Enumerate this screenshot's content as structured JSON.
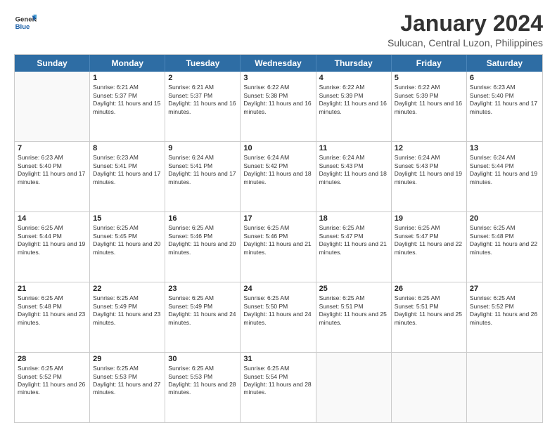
{
  "logo": {
    "general": "General",
    "blue": "Blue"
  },
  "header": {
    "month": "January 2024",
    "location": "Sulucan, Central Luzon, Philippines"
  },
  "days": [
    "Sunday",
    "Monday",
    "Tuesday",
    "Wednesday",
    "Thursday",
    "Friday",
    "Saturday"
  ],
  "weeks": [
    [
      {
        "date": "",
        "sunrise": "",
        "sunset": "",
        "daylight": ""
      },
      {
        "date": "1",
        "sunrise": "Sunrise: 6:21 AM",
        "sunset": "Sunset: 5:37 PM",
        "daylight": "Daylight: 11 hours and 15 minutes."
      },
      {
        "date": "2",
        "sunrise": "Sunrise: 6:21 AM",
        "sunset": "Sunset: 5:37 PM",
        "daylight": "Daylight: 11 hours and 16 minutes."
      },
      {
        "date": "3",
        "sunrise": "Sunrise: 6:22 AM",
        "sunset": "Sunset: 5:38 PM",
        "daylight": "Daylight: 11 hours and 16 minutes."
      },
      {
        "date": "4",
        "sunrise": "Sunrise: 6:22 AM",
        "sunset": "Sunset: 5:39 PM",
        "daylight": "Daylight: 11 hours and 16 minutes."
      },
      {
        "date": "5",
        "sunrise": "Sunrise: 6:22 AM",
        "sunset": "Sunset: 5:39 PM",
        "daylight": "Daylight: 11 hours and 16 minutes."
      },
      {
        "date": "6",
        "sunrise": "Sunrise: 6:23 AM",
        "sunset": "Sunset: 5:40 PM",
        "daylight": "Daylight: 11 hours and 17 minutes."
      }
    ],
    [
      {
        "date": "7",
        "sunrise": "Sunrise: 6:23 AM",
        "sunset": "Sunset: 5:40 PM",
        "daylight": "Daylight: 11 hours and 17 minutes."
      },
      {
        "date": "8",
        "sunrise": "Sunrise: 6:23 AM",
        "sunset": "Sunset: 5:41 PM",
        "daylight": "Daylight: 11 hours and 17 minutes."
      },
      {
        "date": "9",
        "sunrise": "Sunrise: 6:24 AM",
        "sunset": "Sunset: 5:41 PM",
        "daylight": "Daylight: 11 hours and 17 minutes."
      },
      {
        "date": "10",
        "sunrise": "Sunrise: 6:24 AM",
        "sunset": "Sunset: 5:42 PM",
        "daylight": "Daylight: 11 hours and 18 minutes."
      },
      {
        "date": "11",
        "sunrise": "Sunrise: 6:24 AM",
        "sunset": "Sunset: 5:43 PM",
        "daylight": "Daylight: 11 hours and 18 minutes."
      },
      {
        "date": "12",
        "sunrise": "Sunrise: 6:24 AM",
        "sunset": "Sunset: 5:43 PM",
        "daylight": "Daylight: 11 hours and 19 minutes."
      },
      {
        "date": "13",
        "sunrise": "Sunrise: 6:24 AM",
        "sunset": "Sunset: 5:44 PM",
        "daylight": "Daylight: 11 hours and 19 minutes."
      }
    ],
    [
      {
        "date": "14",
        "sunrise": "Sunrise: 6:25 AM",
        "sunset": "Sunset: 5:44 PM",
        "daylight": "Daylight: 11 hours and 19 minutes."
      },
      {
        "date": "15",
        "sunrise": "Sunrise: 6:25 AM",
        "sunset": "Sunset: 5:45 PM",
        "daylight": "Daylight: 11 hours and 20 minutes."
      },
      {
        "date": "16",
        "sunrise": "Sunrise: 6:25 AM",
        "sunset": "Sunset: 5:46 PM",
        "daylight": "Daylight: 11 hours and 20 minutes."
      },
      {
        "date": "17",
        "sunrise": "Sunrise: 6:25 AM",
        "sunset": "Sunset: 5:46 PM",
        "daylight": "Daylight: 11 hours and 21 minutes."
      },
      {
        "date": "18",
        "sunrise": "Sunrise: 6:25 AM",
        "sunset": "Sunset: 5:47 PM",
        "daylight": "Daylight: 11 hours and 21 minutes."
      },
      {
        "date": "19",
        "sunrise": "Sunrise: 6:25 AM",
        "sunset": "Sunset: 5:47 PM",
        "daylight": "Daylight: 11 hours and 22 minutes."
      },
      {
        "date": "20",
        "sunrise": "Sunrise: 6:25 AM",
        "sunset": "Sunset: 5:48 PM",
        "daylight": "Daylight: 11 hours and 22 minutes."
      }
    ],
    [
      {
        "date": "21",
        "sunrise": "Sunrise: 6:25 AM",
        "sunset": "Sunset: 5:48 PM",
        "daylight": "Daylight: 11 hours and 23 minutes."
      },
      {
        "date": "22",
        "sunrise": "Sunrise: 6:25 AM",
        "sunset": "Sunset: 5:49 PM",
        "daylight": "Daylight: 11 hours and 23 minutes."
      },
      {
        "date": "23",
        "sunrise": "Sunrise: 6:25 AM",
        "sunset": "Sunset: 5:49 PM",
        "daylight": "Daylight: 11 hours and 24 minutes."
      },
      {
        "date": "24",
        "sunrise": "Sunrise: 6:25 AM",
        "sunset": "Sunset: 5:50 PM",
        "daylight": "Daylight: 11 hours and 24 minutes."
      },
      {
        "date": "25",
        "sunrise": "Sunrise: 6:25 AM",
        "sunset": "Sunset: 5:51 PM",
        "daylight": "Daylight: 11 hours and 25 minutes."
      },
      {
        "date": "26",
        "sunrise": "Sunrise: 6:25 AM",
        "sunset": "Sunset: 5:51 PM",
        "daylight": "Daylight: 11 hours and 25 minutes."
      },
      {
        "date": "27",
        "sunrise": "Sunrise: 6:25 AM",
        "sunset": "Sunset: 5:52 PM",
        "daylight": "Daylight: 11 hours and 26 minutes."
      }
    ],
    [
      {
        "date": "28",
        "sunrise": "Sunrise: 6:25 AM",
        "sunset": "Sunset: 5:52 PM",
        "daylight": "Daylight: 11 hours and 26 minutes."
      },
      {
        "date": "29",
        "sunrise": "Sunrise: 6:25 AM",
        "sunset": "Sunset: 5:53 PM",
        "daylight": "Daylight: 11 hours and 27 minutes."
      },
      {
        "date": "30",
        "sunrise": "Sunrise: 6:25 AM",
        "sunset": "Sunset: 5:53 PM",
        "daylight": "Daylight: 11 hours and 28 minutes."
      },
      {
        "date": "31",
        "sunrise": "Sunrise: 6:25 AM",
        "sunset": "Sunset: 5:54 PM",
        "daylight": "Daylight: 11 hours and 28 minutes."
      },
      {
        "date": "",
        "sunrise": "",
        "sunset": "",
        "daylight": ""
      },
      {
        "date": "",
        "sunrise": "",
        "sunset": "",
        "daylight": ""
      },
      {
        "date": "",
        "sunrise": "",
        "sunset": "",
        "daylight": ""
      }
    ]
  ]
}
